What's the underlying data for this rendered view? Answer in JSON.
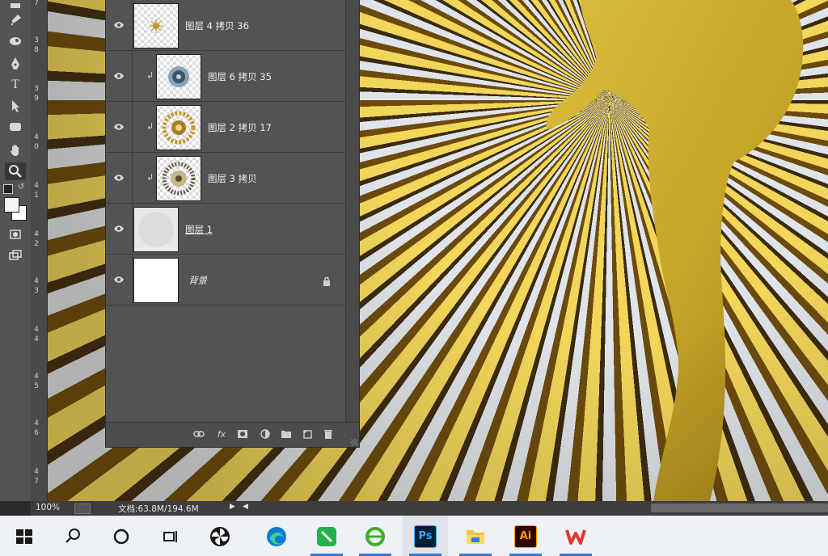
{
  "toolbar": {
    "tools": [
      "brush-tool",
      "blur-tool",
      "pen-tool",
      "type-tool",
      "path-selection-tool",
      "shape-tool",
      "hand-tool",
      "zoom-tool",
      "quick-mask",
      "screen-mode"
    ],
    "type_glyph": "T",
    "active_tool": "zoom-tool"
  },
  "ruler": {
    "labels": [
      "7",
      "3",
      "8",
      "3",
      "9",
      "4",
      "0",
      "4",
      "1",
      "4",
      "2",
      "4",
      "3",
      "4",
      "4",
      "4",
      "5",
      "4",
      "6",
      "4",
      "7"
    ]
  },
  "layers": [
    {
      "name": "图层 4 拷贝 36",
      "clipped": false,
      "thumb": "gold-ornament"
    },
    {
      "name": "图层 6 拷贝 35",
      "clipped": true,
      "thumb": "blue-ornament"
    },
    {
      "name": "图层 2 拷贝 17",
      "clipped": true,
      "thumb": "gold-flower"
    },
    {
      "name": "图层 3 拷贝",
      "clipped": true,
      "thumb": "dark-flower"
    },
    {
      "name": "图层 1",
      "clipped": false,
      "thumb": "gray-circle"
    },
    {
      "name": "背景",
      "clipped": false,
      "thumb": "white",
      "locked": true
    }
  ],
  "panel_footer": {
    "fx_label": "fx"
  },
  "status": {
    "zoom": "100%",
    "doc": "文档:63.8M/194.6M"
  },
  "taskbar": {
    "items": [
      "start-button",
      "search-button",
      "cortana-button",
      "task-view-button",
      "app-pinwheel",
      "edge-browser",
      "green-app",
      "ie-browser",
      "photoshop",
      "file-explorer",
      "illustrator",
      "wps-office"
    ],
    "ps_label": "Ps",
    "ai_label": "Ai",
    "active": "photoshop"
  },
  "colors": {
    "ps_blue": "#31a8ff",
    "ai_orange": "#ff9a00",
    "wps_red": "#e8352b",
    "edge_blue": "#0f7bd4",
    "green_app": "#22b14c"
  }
}
